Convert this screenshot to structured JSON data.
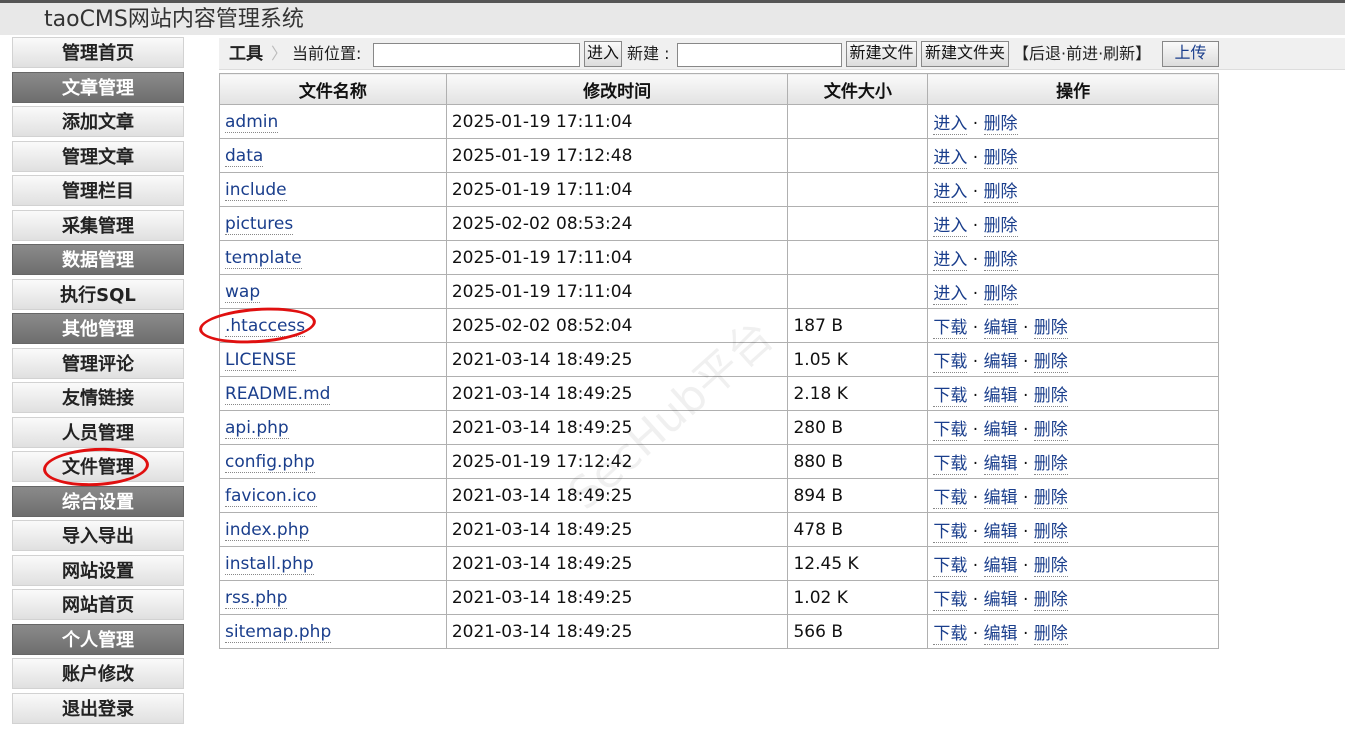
{
  "header": {
    "title": "taoCMS网站内容管理系统"
  },
  "sidebar": {
    "items": [
      {
        "label": "管理首页",
        "type": "link"
      },
      {
        "label": "文章管理",
        "type": "section"
      },
      {
        "label": "添加文章",
        "type": "link"
      },
      {
        "label": "管理文章",
        "type": "link"
      },
      {
        "label": "管理栏目",
        "type": "link"
      },
      {
        "label": "采集管理",
        "type": "link"
      },
      {
        "label": "数据管理",
        "type": "section"
      },
      {
        "label": "执行SQL",
        "type": "link"
      },
      {
        "label": "其他管理",
        "type": "section"
      },
      {
        "label": "管理评论",
        "type": "link"
      },
      {
        "label": "友情链接",
        "type": "link"
      },
      {
        "label": "人员管理",
        "type": "link"
      },
      {
        "label": "文件管理",
        "type": "link"
      },
      {
        "label": "综合设置",
        "type": "section"
      },
      {
        "label": "导入导出",
        "type": "link"
      },
      {
        "label": "网站设置",
        "type": "link"
      },
      {
        "label": "网站首页",
        "type": "link"
      },
      {
        "label": "个人管理",
        "type": "section"
      },
      {
        "label": "账户修改",
        "type": "link"
      },
      {
        "label": "退出登录",
        "type": "link"
      }
    ]
  },
  "toolbar": {
    "tool_label": "工具",
    "current_location_label": "当前位置:",
    "current_location_value": "",
    "enter_button": "进入",
    "new_label": "新建 :",
    "new_value": "",
    "new_file_button": "新建文件",
    "new_folder_button": "新建文件夹",
    "nav_links": "【后退·前进·刷新】",
    "upload_button": "上传"
  },
  "table": {
    "headers": [
      "文件名称",
      "修改时间",
      "文件大小",
      "操作"
    ],
    "rows": [
      {
        "name": "admin",
        "modified": "2025-01-19 17:11:04",
        "size": "",
        "actions": [
          "进入",
          "删除"
        ]
      },
      {
        "name": "data",
        "modified": "2025-01-19 17:12:48",
        "size": "",
        "actions": [
          "进入",
          "删除"
        ]
      },
      {
        "name": "include",
        "modified": "2025-01-19 17:11:04",
        "size": "",
        "actions": [
          "进入",
          "删除"
        ]
      },
      {
        "name": "pictures",
        "modified": "2025-02-02 08:53:24",
        "size": "",
        "actions": [
          "进入",
          "删除"
        ]
      },
      {
        "name": "template",
        "modified": "2025-01-19 17:11:04",
        "size": "",
        "actions": [
          "进入",
          "删除"
        ]
      },
      {
        "name": "wap",
        "modified": "2025-01-19 17:11:04",
        "size": "",
        "actions": [
          "进入",
          "删除"
        ]
      },
      {
        "name": ".htaccess",
        "modified": "2025-02-02 08:52:04",
        "size": "187 B",
        "actions": [
          "下载",
          "编辑",
          "删除"
        ]
      },
      {
        "name": "LICENSE",
        "modified": "2021-03-14 18:49:25",
        "size": "1.05 K",
        "actions": [
          "下载",
          "编辑",
          "删除"
        ]
      },
      {
        "name": "README.md",
        "modified": "2021-03-14 18:49:25",
        "size": "2.18 K",
        "actions": [
          "下载",
          "编辑",
          "删除"
        ]
      },
      {
        "name": "api.php",
        "modified": "2021-03-14 18:49:25",
        "size": "280 B",
        "actions": [
          "下载",
          "编辑",
          "删除"
        ]
      },
      {
        "name": "config.php",
        "modified": "2025-01-19 17:12:42",
        "size": "880 B",
        "actions": [
          "下载",
          "编辑",
          "删除"
        ]
      },
      {
        "name": "favicon.ico",
        "modified": "2021-03-14 18:49:25",
        "size": "894 B",
        "actions": [
          "下载",
          "编辑",
          "删除"
        ]
      },
      {
        "name": "index.php",
        "modified": "2021-03-14 18:49:25",
        "size": "478 B",
        "actions": [
          "下载",
          "编辑",
          "删除"
        ]
      },
      {
        "name": "install.php",
        "modified": "2021-03-14 18:49:25",
        "size": "12.45 K",
        "actions": [
          "下载",
          "编辑",
          "删除"
        ]
      },
      {
        "name": "rss.php",
        "modified": "2021-03-14 18:49:25",
        "size": "1.02 K",
        "actions": [
          "下载",
          "编辑",
          "删除"
        ]
      },
      {
        "name": "sitemap.php",
        "modified": "2021-03-14 18:49:25",
        "size": "566 B",
        "actions": [
          "下载",
          "编辑",
          "删除"
        ]
      }
    ]
  },
  "watermark": "SecHub平台",
  "colors": {
    "section_bg": "#7a7a7a",
    "link": "#1a3e8c",
    "annotation_red": "#e01010"
  }
}
